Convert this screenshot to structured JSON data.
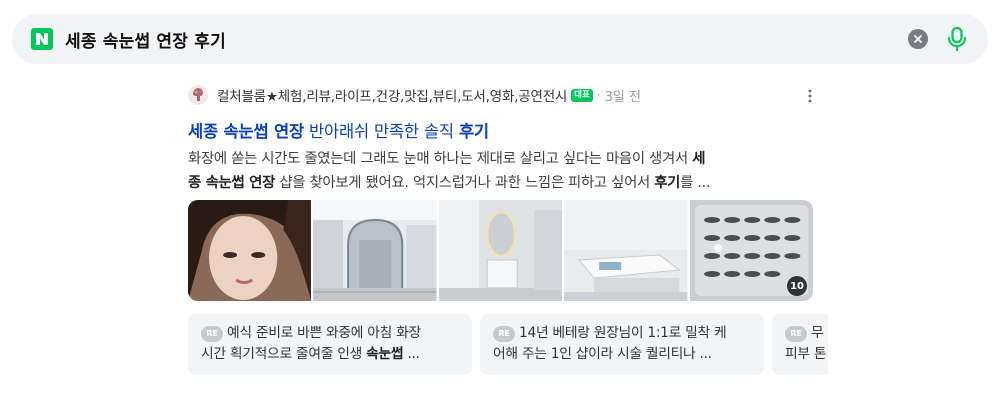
{
  "search": {
    "query": "세종 속눈썹 연장 후기",
    "brand_color": "#03c75a",
    "icons": {
      "logo": "naver-n-logo",
      "clear": "clear-icon",
      "mic": "mic-icon"
    }
  },
  "result": {
    "author": "컬처블룸★체험,리뷰,라이프,건강,맛집,뷰티,도서,영화,공연전시",
    "badge": "대표",
    "separator": "·",
    "time": "3일 전",
    "title": {
      "part1": "세종 속눈썹 연장",
      "part2": " 반아래쉬 만족한 솔직 ",
      "part3": "후기"
    },
    "title_color": "#0a3fb5",
    "snippet": {
      "line1_a": "화장에 쏟는 시간도 줄였는데 그래도 눈매 하나는 제대로 살리고 싶다는 마음이 생겨서 ",
      "line1_b": "세",
      "line2_a": "종 속눈썹 연장",
      "line2_b": " 샵을 찾아보게 됐어요. 억지스럽거나 과한 느낌은 피하고 싶어서 ",
      "line2_c": "후기",
      "line2_d": "를 ..."
    },
    "thumbnails": [
      "portrait-photo",
      "shop-entrance-photo",
      "mirror-sink-photo",
      "treatment-bed-photo",
      "eyelash-tray-photo"
    ],
    "image_count": "10"
  },
  "related": [
    {
      "tag": "RE",
      "line1": "예식 준비로 바쁜 와중에 아침 화장",
      "line2_a": "시간 획기적으로 줄여줄 인생 ",
      "line2_b": "속눈썹",
      "line2_c": " ..."
    },
    {
      "tag": "RE",
      "line1": "14년 베테랑 원장님이 1:1로 밀착 케",
      "line2_a": "어해 주는 1인 샵이라 시술 퀄리티나 ..."
    },
    {
      "tag": "RE",
      "line1": "무",
      "line2_a": "피부 톤"
    }
  ]
}
